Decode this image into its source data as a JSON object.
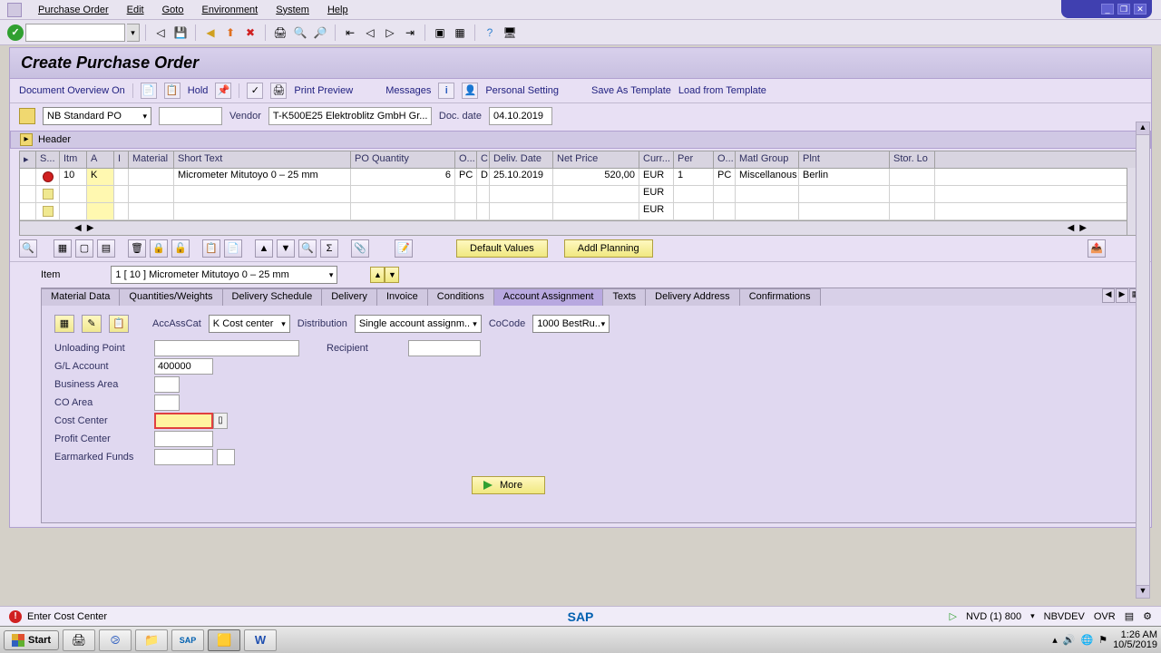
{
  "menu": {
    "items": [
      "Purchase Order",
      "Edit",
      "Goto",
      "Environment",
      "System",
      "Help"
    ]
  },
  "title": "Create Purchase Order",
  "action_bar": {
    "doc_overview": "Document Overview On",
    "hold": "Hold",
    "print_preview": "Print Preview",
    "messages": "Messages",
    "personal_setting": "Personal Setting",
    "save_template": "Save As Template",
    "load_template": "Load from Template"
  },
  "doc_header": {
    "doc_type": "NB Standard PO",
    "po_number": "",
    "vendor_label": "Vendor",
    "vendor_value": "T-K500E25 Elektroblitz GmbH Gr...",
    "doc_date_label": "Doc. date",
    "doc_date_value": "04.10.2019",
    "header_label": "Header"
  },
  "grid": {
    "columns": [
      "S...",
      "Itm",
      "A",
      "I",
      "Material",
      "Short Text",
      "PO Quantity",
      "O...",
      "C",
      "Deliv. Date",
      "Net Price",
      "Curr...",
      "Per",
      "O...",
      "Matl Group",
      "Plnt",
      "Stor. Lo"
    ],
    "rows": [
      {
        "status": "err",
        "itm": "10",
        "a": "K",
        "i": "",
        "material": "",
        "short_text": "Micrometer Mitutoyo 0 – 25 mm",
        "qty": "6",
        "oun": "PC",
        "c": "D",
        "deliv": "25.10.2019",
        "price": "520,00",
        "curr": "EUR",
        "per": "1",
        "opu": "PC",
        "matl": "Miscellanous",
        "plnt": "Berlin",
        "stor": ""
      },
      {
        "curr": "EUR"
      },
      {
        "curr": "EUR"
      }
    ]
  },
  "item_toolbar": {
    "default_values": "Default Values",
    "addl_planning": "Addl Planning"
  },
  "item_section": {
    "label": "Item",
    "selected": "1 [ 10 ] Micrometer Mitutoyo 0 – 25 mm"
  },
  "tabs": [
    "Material Data",
    "Quantities/Weights",
    "Delivery Schedule",
    "Delivery",
    "Invoice",
    "Conditions",
    "Account Assignment",
    "Texts",
    "Delivery Address",
    "Confirmations"
  ],
  "active_tab": "Account Assignment",
  "account_assignment": {
    "acc_ass_cat_label": "AccAssCat",
    "acc_ass_cat_value": "K Cost center",
    "distribution_label": "Distribution",
    "distribution_value": "Single account assignm..",
    "cocode_label": "CoCode",
    "cocode_value": "1000 BestRu..",
    "fields": {
      "unloading_point": {
        "label": "Unloading Point",
        "value": ""
      },
      "recipient": {
        "label": "Recipient",
        "value": ""
      },
      "gl_account": {
        "label": "G/L Account",
        "value": "400000"
      },
      "business_area": {
        "label": "Business Area",
        "value": ""
      },
      "co_area": {
        "label": "CO Area",
        "value": ""
      },
      "cost_center": {
        "label": "Cost Center",
        "value": ""
      },
      "profit_center": {
        "label": "Profit Center",
        "value": ""
      },
      "earmarked_funds": {
        "label": "Earmarked Funds",
        "value": ""
      }
    },
    "more": "More"
  },
  "status": {
    "message": "Enter Cost Center",
    "system": "NVD (1) 800",
    "server": "NBVDEV",
    "mode": "OVR",
    "sap": "SAP"
  },
  "taskbar": {
    "start": "Start",
    "time": "1:26 AM",
    "date": "10/5/2019"
  }
}
